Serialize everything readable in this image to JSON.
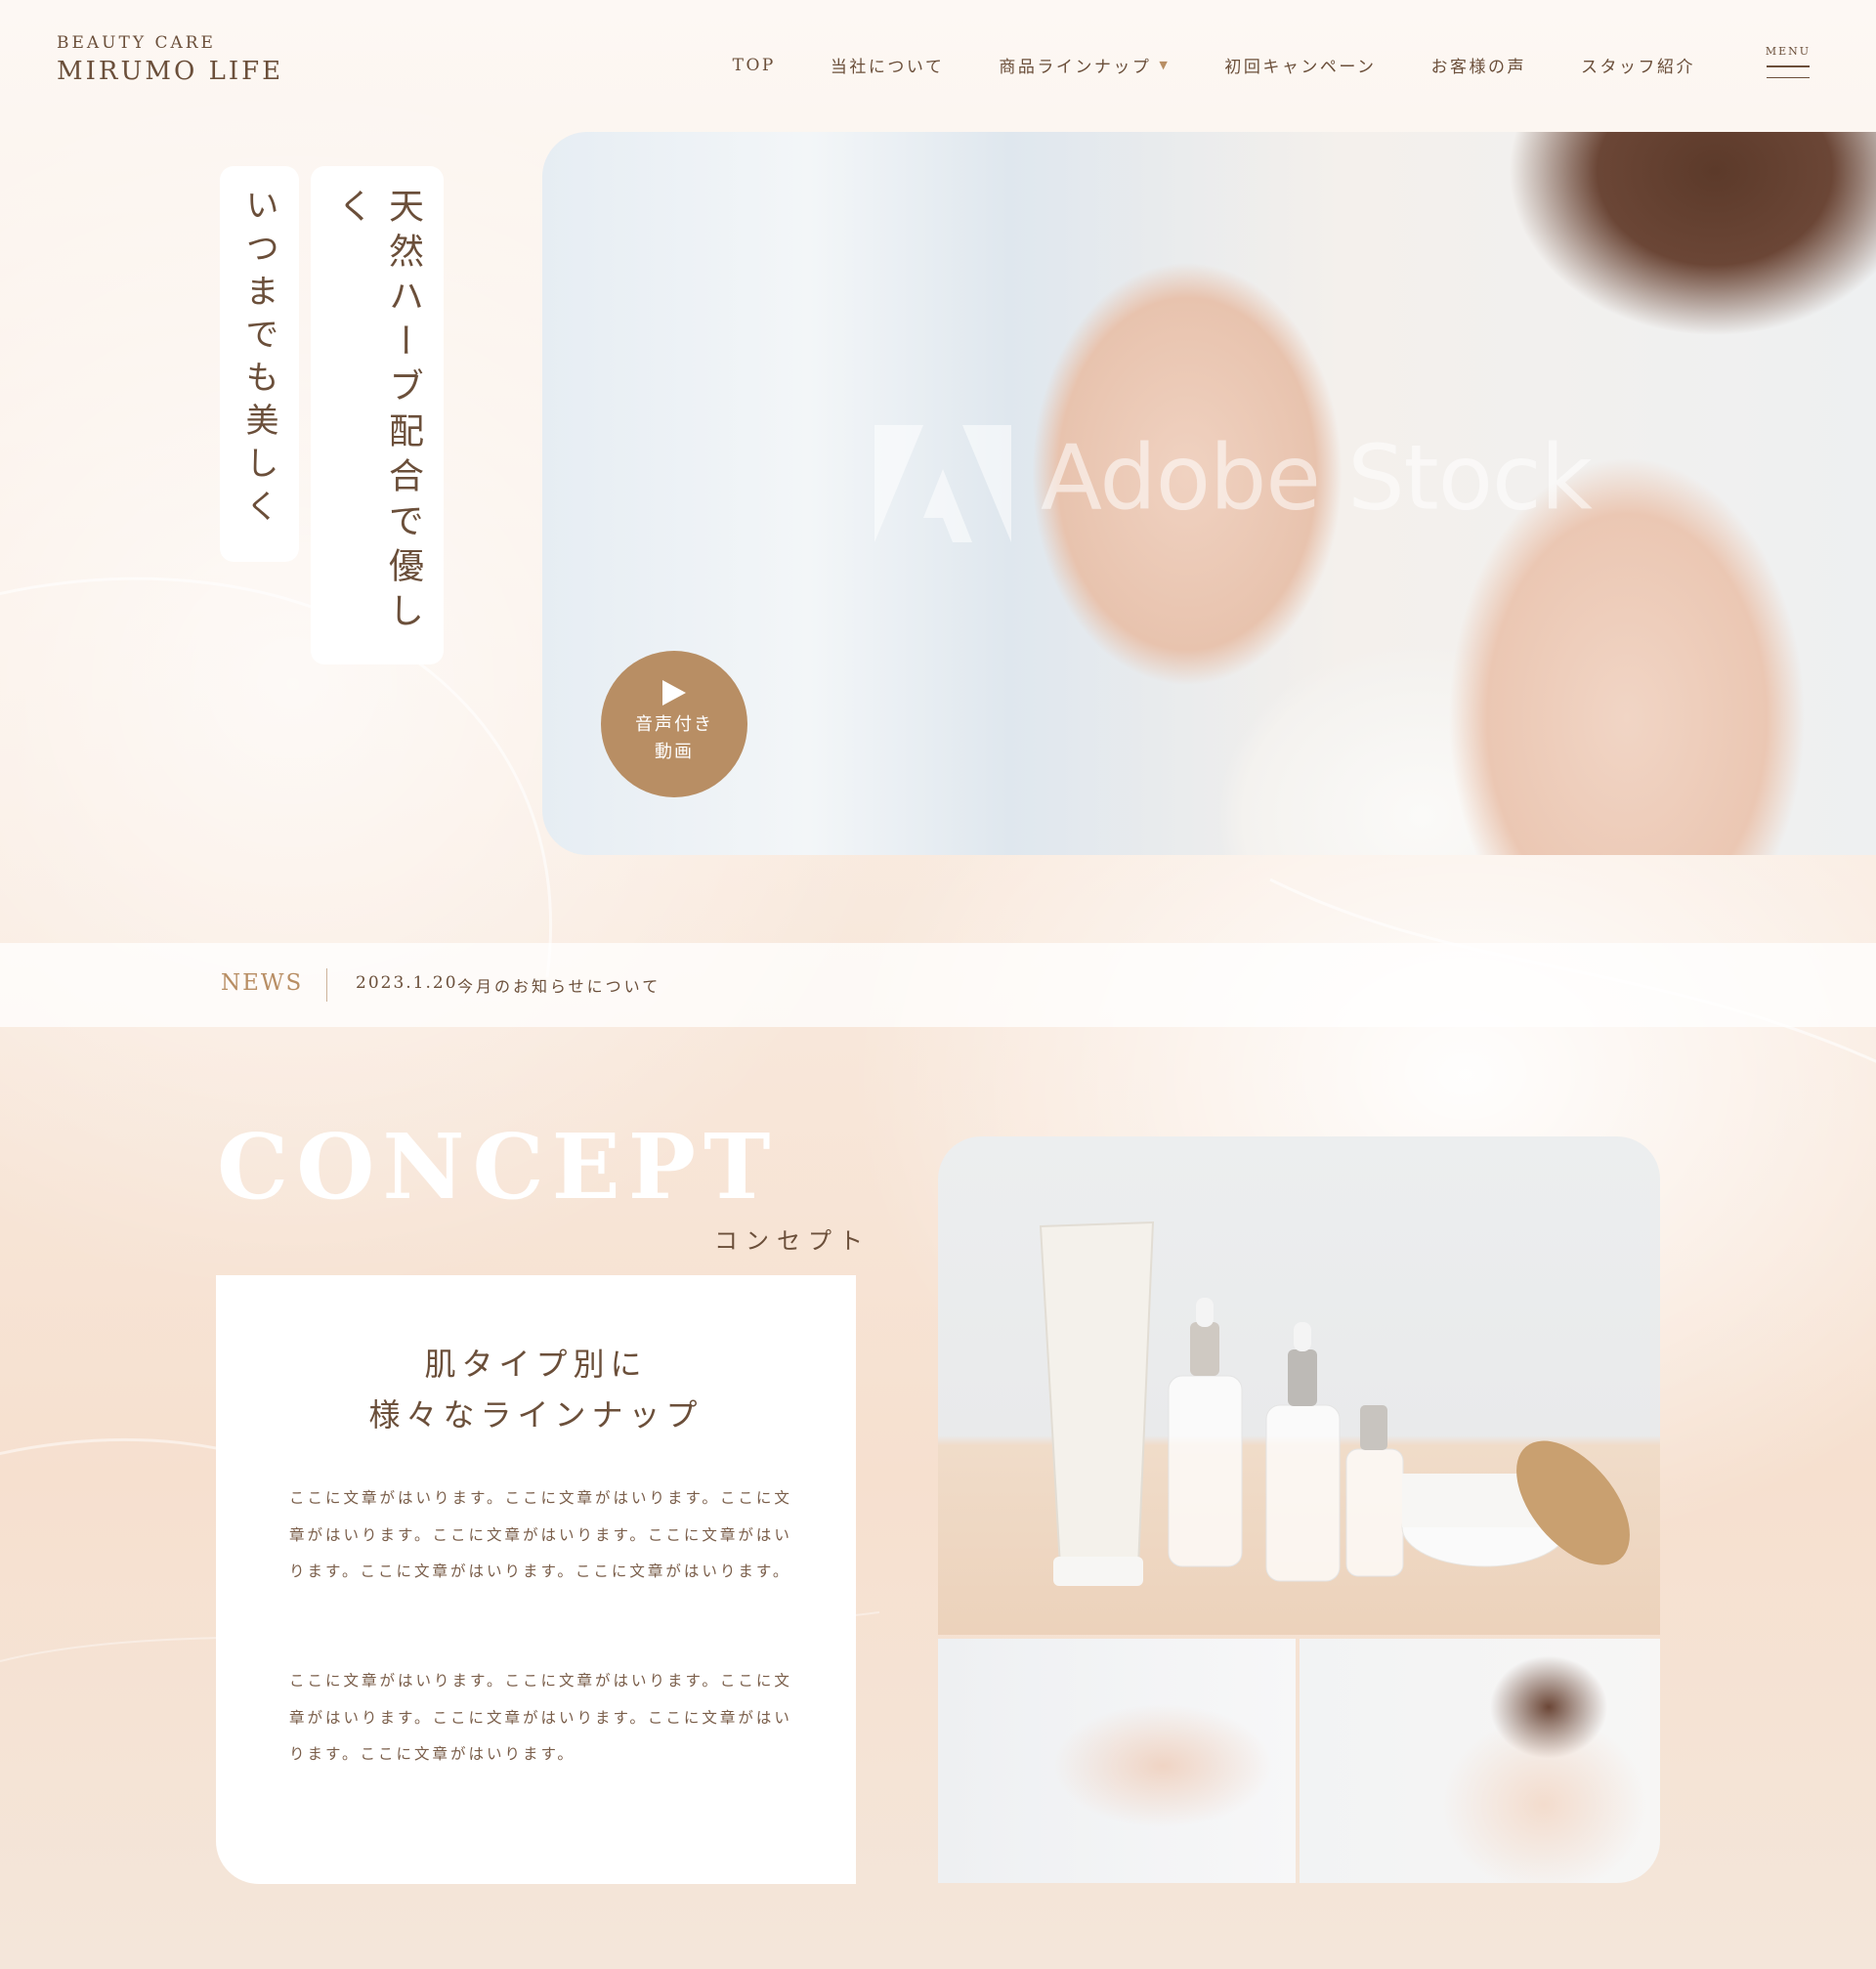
{
  "brand": {
    "sub": "BEAUTY CARE",
    "name": "MIRUMO LIFE"
  },
  "nav": {
    "items": [
      {
        "label": "TOP"
      },
      {
        "label": "当社について"
      },
      {
        "label": "商品ラインナップ",
        "has_dropdown": true
      },
      {
        "label": "初回キャンペーン"
      },
      {
        "label": "お客様の声"
      },
      {
        "label": "スタッフ紹介"
      }
    ],
    "menu_label": "MENU"
  },
  "hero": {
    "copy_1": "天然ハーブ配合で優しく",
    "copy_2": "いつまでも美しく",
    "watermark": "Adobe Stock",
    "video_button": {
      "line1": "音声付き",
      "line2": "動画"
    }
  },
  "news": {
    "label": "NEWS",
    "date": "2023.1.20",
    "title": "今月のお知らせについて"
  },
  "concept": {
    "title": "CONCEPT",
    "subtitle": "コンセプト",
    "heading_line1": "肌タイプ別に",
    "heading_line2": "様々なラインナップ",
    "paragraph1": "ここに文章がはいります。ここに文章がはいります。ここに文章がはいります。ここに文章がはいります。ここに文章がはいります。ここに文章がはいります。ここに文章がはいります。",
    "paragraph2": "ここに文章がはいります。ここに文章がはいります。ここに文章がはいります。ここに文章がはいります。ここに文章がはいります。ここに文章がはいります。"
  },
  "colors": {
    "accent": "#b88e64",
    "text": "#6b4f3a",
    "background": "#f9ebe0"
  }
}
